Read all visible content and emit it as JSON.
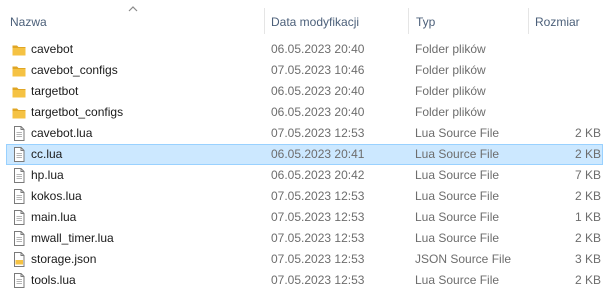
{
  "columns": {
    "name": "Nazwa",
    "date": "Data modyfikacji",
    "type": "Typ",
    "size": "Rozmiar"
  },
  "sort": {
    "column": "name",
    "direction": "ascending",
    "icon": "sort-up-arrow-icon"
  },
  "selected_index": 5,
  "files": [
    {
      "name": "cavebot",
      "date": "06.05.2023 20:40",
      "type": "Folder plików",
      "size": "",
      "icon": "folder-icon"
    },
    {
      "name": "cavebot_configs",
      "date": "07.05.2023 10:46",
      "type": "Folder plików",
      "size": "",
      "icon": "folder-icon"
    },
    {
      "name": "targetbot",
      "date": "06.05.2023 20:40",
      "type": "Folder plików",
      "size": "",
      "icon": "folder-icon"
    },
    {
      "name": "targetbot_configs",
      "date": "06.05.2023 20:40",
      "type": "Folder plików",
      "size": "",
      "icon": "folder-icon"
    },
    {
      "name": "cavebot.lua",
      "date": "07.05.2023 12:53",
      "type": "Lua Source File",
      "size": "2 KB",
      "icon": "file-icon"
    },
    {
      "name": "cc.lua",
      "date": "06.05.2023 20:41",
      "type": "Lua Source File",
      "size": "2 KB",
      "icon": "file-icon"
    },
    {
      "name": "hp.lua",
      "date": "06.05.2023 20:42",
      "type": "Lua Source File",
      "size": "7 KB",
      "icon": "file-icon"
    },
    {
      "name": "kokos.lua",
      "date": "07.05.2023 12:53",
      "type": "Lua Source File",
      "size": "2 KB",
      "icon": "file-icon"
    },
    {
      "name": "main.lua",
      "date": "07.05.2023 12:53",
      "type": "Lua Source File",
      "size": "1 KB",
      "icon": "file-icon"
    },
    {
      "name": "mwall_timer.lua",
      "date": "07.05.2023 12:53",
      "type": "Lua Source File",
      "size": "2 KB",
      "icon": "file-icon"
    },
    {
      "name": "storage.json",
      "date": "07.05.2023 12:53",
      "type": "JSON Source File",
      "size": "3 KB",
      "icon": "json-file-icon"
    },
    {
      "name": "tools.lua",
      "date": "07.05.2023 12:53",
      "type": "Lua Source File",
      "size": "2 KB",
      "icon": "file-icon"
    }
  ],
  "colors": {
    "folder": "#f5c243",
    "folder_dark": "#e0a624",
    "selection_fill": "#cce8ff",
    "selection_border": "#99d1ff",
    "header_text": "#4c607a"
  }
}
